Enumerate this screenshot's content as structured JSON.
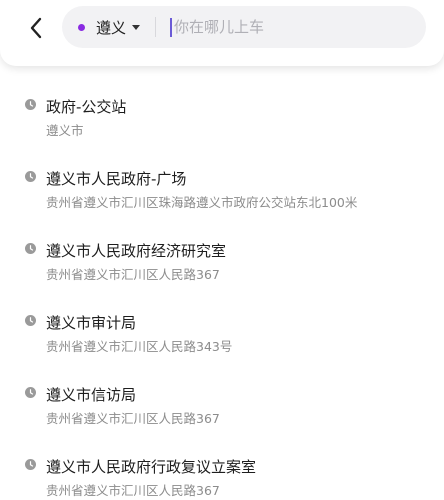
{
  "search": {
    "city": "遵义",
    "placeholder": "你在哪儿上车",
    "value": ""
  },
  "colors": {
    "accent": "#8a2be2",
    "cursor": "#6b5bd6",
    "icon_gray": "#9a9a9a"
  },
  "results": [
    {
      "title": "政府-公交站",
      "address": "遵义市"
    },
    {
      "title": "遵义市人民政府-广场",
      "address": "贵州省遵义市汇川区珠海路遵义市政府公交站东北100米"
    },
    {
      "title": "遵义市人民政府经济研究室",
      "address": "贵州省遵义市汇川区人民路367"
    },
    {
      "title": "遵义市审计局",
      "address": "贵州省遵义市汇川区人民路343号"
    },
    {
      "title": "遵义市信访局",
      "address": "贵州省遵义市汇川区人民路367"
    },
    {
      "title": "遵义市人民政府行政复议立案室",
      "address": "贵州省遵义市汇川区人民路367"
    }
  ]
}
